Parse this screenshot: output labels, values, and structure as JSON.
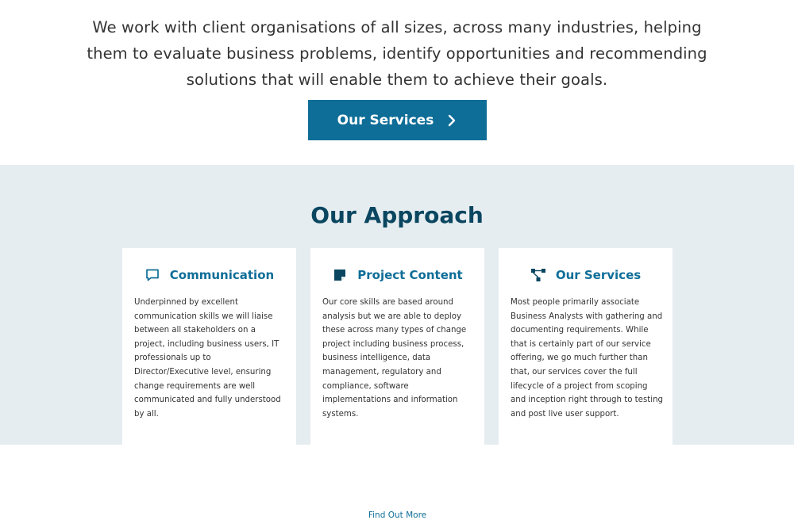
{
  "intro": {
    "text": "We work with client organisations of all sizes, across many industries, helping them to evaluate business problems, identify opportunities and recommending solutions that will enable them to achieve their goals.",
    "cta_label": "Our Services"
  },
  "approach": {
    "title": "Our Approach",
    "cards": [
      {
        "icon": "speech-bubble-icon",
        "title": "Communication",
        "body": "Underpinned by excellent communication skills we will liaise between all stakeholders on a project, including business users, IT professionals up to Director/Executive level, ensuring change requirements are well communicated and fully understood by all."
      },
      {
        "icon": "note-icon",
        "title": "Project Content",
        "body": "Our core skills are based around analysis but we are able to deploy these across many types of change project including business process, business intelligence, data management, regulatory and compliance, software implementations and information systems.",
        "link": "Find Out More"
      },
      {
        "icon": "sitemap-icon",
        "title": "Our Services",
        "body": "Most people primarily associate Business Analysts with gathering and documenting requirements. While that is certainly part of our service offering, we go much further than that, our services cover the full lifecycle of a project from scoping and inception right through to testing and post live user support."
      }
    ]
  },
  "colors": {
    "accent": "#0f6e98",
    "heading": "#0a4660",
    "section_bg": "#e6edf0"
  }
}
